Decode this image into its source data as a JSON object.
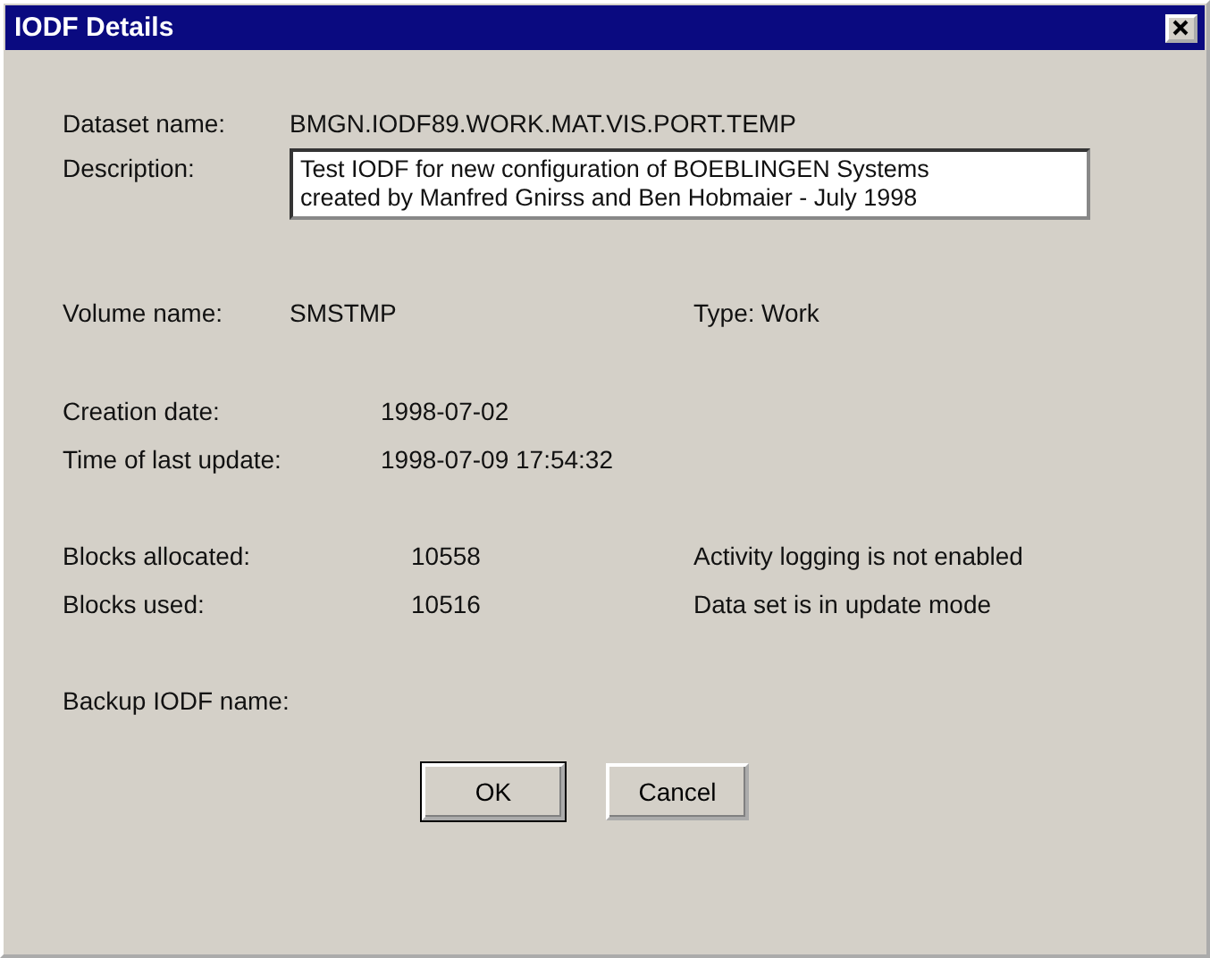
{
  "window": {
    "title": "IODF Details"
  },
  "dataset": {
    "label": "Dataset name:",
    "value": "BMGN.IODF89.WORK.MAT.VIS.PORT.TEMP"
  },
  "description": {
    "label": "Description:",
    "lines": [
      "Test IODF for new configuration of BOEBLINGEN Systems",
      "created by Manfred Gnirss and Ben Hobmaier - July 1998"
    ]
  },
  "volume": {
    "label": "Volume name:",
    "value": "SMSTMP"
  },
  "type": {
    "label": "Type:",
    "value": "Work"
  },
  "dates": [
    {
      "label": "Creation date:",
      "value": "1998-07-02"
    },
    {
      "label": "Time of last update:",
      "value": "1998-07-09 17:54:32"
    }
  ],
  "blocks": [
    {
      "label": "Blocks allocated:",
      "value": "10558",
      "note": "Activity logging is not enabled"
    },
    {
      "label": "Blocks used:",
      "value": "10516",
      "note": "Data set is in update mode"
    }
  ],
  "backup": {
    "label": "Backup IODF name:"
  },
  "buttons": [
    {
      "label": "OK",
      "default": true
    },
    {
      "label": "Cancel",
      "default": false
    }
  ]
}
